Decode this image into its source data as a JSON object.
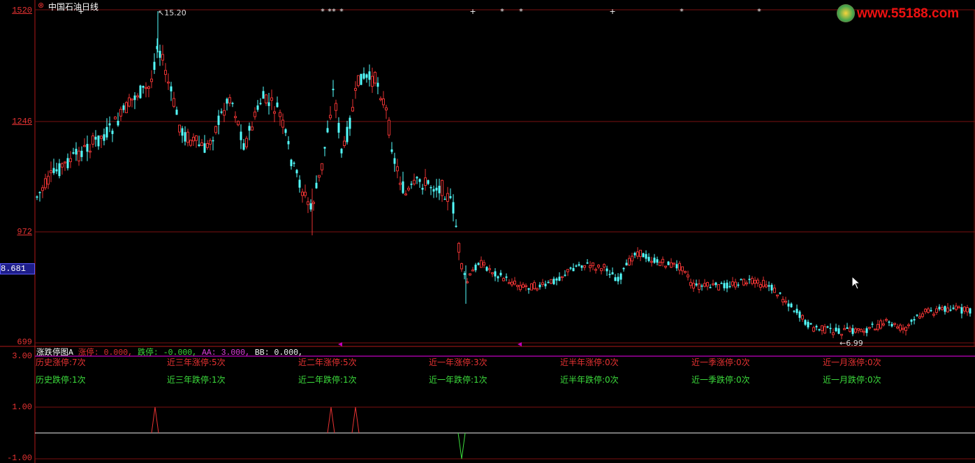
{
  "chart_title": "中国石油日线",
  "price_axis": {
    "top": "1520",
    "mid1": "1246",
    "mid2": "972",
    "bottom": "699",
    "current": "8.681"
  },
  "high_label": "15.20",
  "low_label": "6.99",
  "watermark": "www.55188.com",
  "indicator": {
    "name": "涨跌停图A",
    "zt": "涨停: 0.000,",
    "dt": "跌停: -0.000,",
    "aa": "AA: 3.000,",
    "bb": "BB: 0.000,"
  },
  "sub_axis": {
    "top": "3.00",
    "mid": "1.00",
    "bottom": "-1.00"
  },
  "stats_up": [
    "历史涨停:7次",
    "近三年涨停:5次",
    "近二年涨停:5次",
    "近一年涨停:3次",
    "近半年涨停:0次",
    "近一季涨停:0次",
    "近一月涨停:0次"
  ],
  "stats_down": [
    "历史跌停:1次",
    "近三年跌停:1次",
    "近二年跌停:1次",
    "近一年跌停:1次",
    "近半年跌停:0次",
    "近一季跌停:0次",
    "近一月跌停:0次"
  ],
  "colors": {
    "up": "#e63232",
    "down": "#54ffff",
    "grid": "#7a1010",
    "accent": "#c000c0"
  },
  "markers": [
    "+",
    "*",
    "*",
    "*",
    "*",
    "+",
    "*",
    "*",
    "+",
    "*",
    "*",
    "*"
  ]
}
